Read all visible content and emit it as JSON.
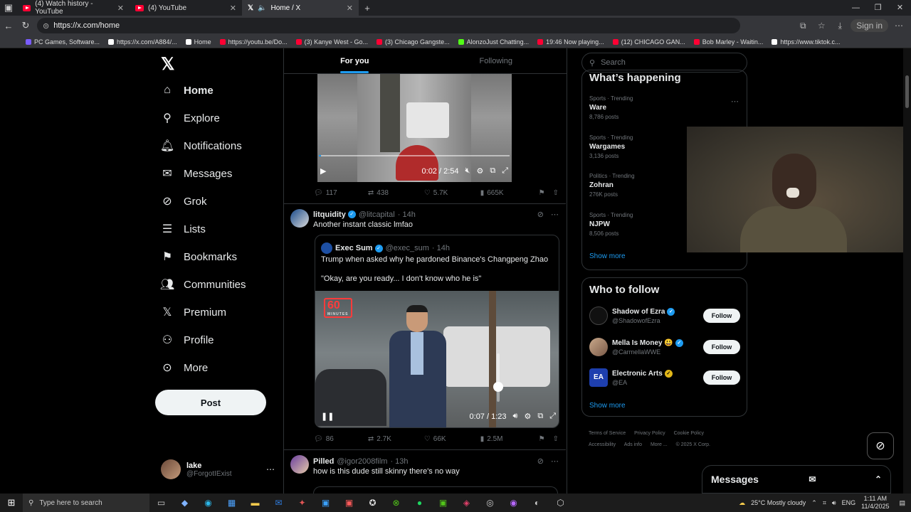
{
  "browser": {
    "tabs": [
      {
        "label": "(4) Watch history - YouTube",
        "icon": "youtube-icon"
      },
      {
        "label": "(4) YouTube",
        "icon": "youtube-icon"
      },
      {
        "label": "Home / X",
        "icon": "x-icon",
        "active": true
      }
    ],
    "url": "https://x.com/home",
    "signin": "Sign in",
    "bookmarks": [
      "PC Games, Software...",
      "https://x.com/A884/...",
      "Home",
      "https://youtu.be/Do...",
      "(3) Kanye West - Go...",
      "(3) Chicago Gangste...",
      "AlonzoJust Chatting...",
      "19:46 Now playing...",
      "(12) CHICAGO GAN...",
      "Bob Marley - Waitin...",
      "https://www.tiktok.c..."
    ]
  },
  "nav": {
    "items": [
      "Home",
      "Explore",
      "Notifications",
      "Messages",
      "Grok",
      "Lists",
      "Bookmarks",
      "Communities",
      "Premium",
      "Profile",
      "More"
    ],
    "post": "Post",
    "account": {
      "name": "lake",
      "handle": "@ForgotIExist"
    }
  },
  "feed": {
    "tabs": [
      "For you",
      "Following"
    ],
    "video1": {
      "time": "0:02 / 2:54",
      "progress": 0.01,
      "stats": {
        "replies": "117",
        "reposts": "438",
        "likes": "5.7K",
        "views": "665K"
      }
    },
    "tweet1": {
      "name": "litquidity",
      "handle": "@litcapital",
      "age": "· 14h",
      "text": "Another instant classic lmfao",
      "quote": {
        "name": "Exec Sum",
        "handle": "@exec_sum",
        "age": "· 14h",
        "text": "Trump when asked why he pardoned Binance's Changpeng Zhao",
        "subtext": "\"Okay, are you ready... I don't know who he is\"",
        "logo": "60",
        "logo_sub": "MINUTES",
        "time": "0:07 / 1:23"
      },
      "stats": {
        "replies": "86",
        "reposts": "2.7K",
        "likes": "66K",
        "views": "2.5M"
      }
    },
    "tweet2": {
      "name": "Pilled",
      "handle": "@igor2008film",
      "age": "· 13h",
      "text": "how is this dude still skinny there's no way"
    }
  },
  "sidebar": {
    "search_placeholder": "Search",
    "happening_title": "What’s happening",
    "trends": [
      {
        "cat": "Sports · Trending",
        "name": "Ware",
        "count": "8,786 posts"
      },
      {
        "cat": "Sports · Trending",
        "name": "Wargames",
        "count": "3,136 posts"
      },
      {
        "cat": "Politics · Trending",
        "name": "Zohran",
        "count": "276K posts"
      },
      {
        "cat": "Sports · Trending",
        "name": "NJPW",
        "count": "8,506 posts"
      }
    ],
    "show_more": "Show more",
    "who_title": "Who to follow",
    "follow": [
      {
        "name": "Shadow of Ezra",
        "handle": "@ShadowofEzra",
        "badge": "blue"
      },
      {
        "name": "Mella Is Money 😃",
        "handle": "@CarmellaWWE",
        "badge": "blue"
      },
      {
        "name": "Electronic Arts",
        "handle": "@EA",
        "badge": "gold"
      }
    ],
    "follow_label": "Follow",
    "footer": [
      "Terms of Service",
      "Privacy Policy",
      "Cookie Policy",
      "Accessibility",
      "Ads info",
      "More ...",
      "© 2025 X Corp."
    ]
  },
  "messages_drawer": "Messages",
  "taskbar": {
    "search_placeholder": "Type here to search",
    "weather": "25°C  Mostly cloudy",
    "lang": "ENG",
    "time": "1:11 AM",
    "date": "11/4/2025"
  }
}
